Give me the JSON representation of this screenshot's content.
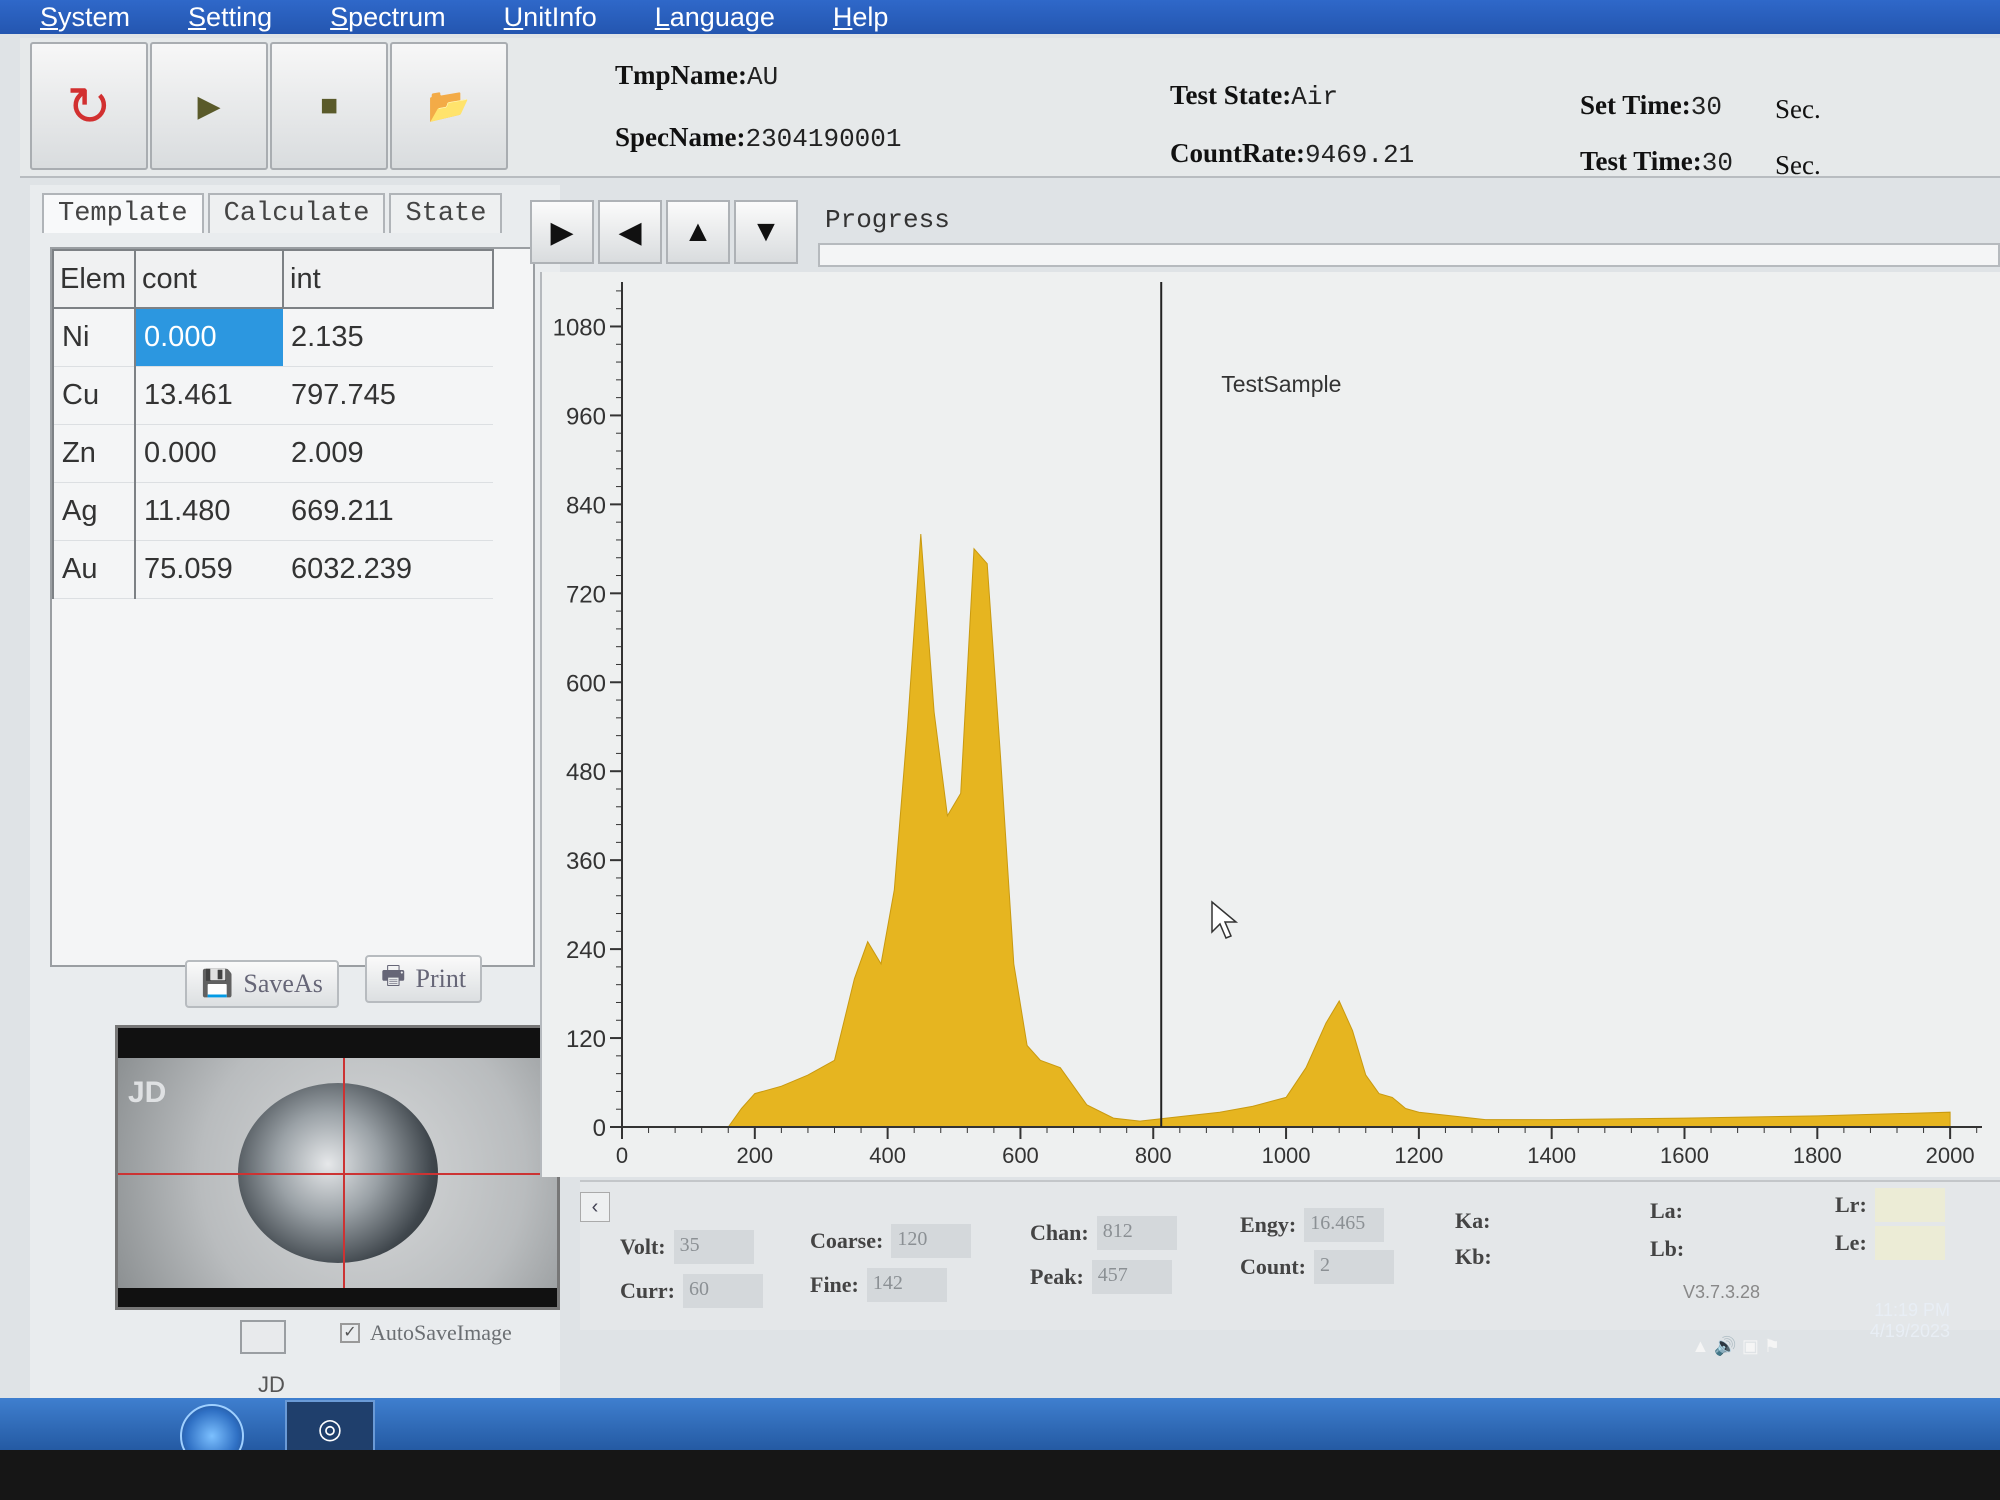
{
  "menu": [
    "System",
    "Setting",
    "Spectrum",
    "UnitInfo",
    "Language",
    "Help"
  ],
  "toolbar": {
    "tmp_label": "TmpName:",
    "tmp_value": "AU",
    "spec_label": "SpecName:",
    "spec_value": "2304190001",
    "state_label": "Test State:",
    "state_value": "Air",
    "rate_label": "CountRate:",
    "rate_value": "9469.21",
    "settime_label": "Set Time:",
    "settime_value": "30",
    "settime_unit": "Sec.",
    "testtime_label": "Test Time:",
    "testtime_value": "30",
    "testtime_unit": "Sec."
  },
  "left": {
    "tabs": [
      "Template",
      "Calculate",
      "State"
    ],
    "table": {
      "headers": [
        "Elem",
        "cont",
        "int"
      ],
      "rows": [
        [
          "Ni",
          "0.000",
          "2.135"
        ],
        [
          "Cu",
          "13.461",
          "797.745"
        ],
        [
          "Zn",
          "0.000",
          "2.009"
        ],
        [
          "Ag",
          "11.480",
          "669.211"
        ],
        [
          "Au",
          "75.059",
          "6032.239"
        ]
      ]
    },
    "saveas_label": "SaveAs",
    "print_label": "Print",
    "camera_overlay": "JD",
    "autosave_label": "AutoSaveImage",
    "footer_label": "JD"
  },
  "progress_label": "Progress",
  "chart_data": {
    "type": "area",
    "title": "TestSample",
    "xlim": [
      0,
      2048
    ],
    "ylim": [
      0,
      1140
    ],
    "x_ticks": [
      0,
      200,
      400,
      600,
      800,
      1000,
      1200,
      1400,
      1600,
      1800,
      2000
    ],
    "y_ticks": [
      0,
      120,
      240,
      360,
      480,
      600,
      720,
      840,
      960,
      1080
    ],
    "marker_x": 812,
    "fill_color": "#e6b520",
    "x": [
      0,
      160,
      180,
      200,
      240,
      280,
      320,
      350,
      370,
      390,
      410,
      430,
      450,
      470,
      490,
      510,
      530,
      550,
      570,
      590,
      610,
      630,
      660,
      700,
      740,
      780,
      800,
      850,
      900,
      950,
      1000,
      1030,
      1060,
      1080,
      1100,
      1120,
      1140,
      1160,
      1180,
      1200,
      1260,
      1300,
      1400,
      1600,
      1800,
      2000
    ],
    "y": [
      0,
      0,
      25,
      45,
      55,
      70,
      90,
      200,
      250,
      220,
      320,
      540,
      800,
      560,
      420,
      450,
      780,
      760,
      500,
      220,
      110,
      90,
      80,
      30,
      12,
      8,
      10,
      15,
      20,
      28,
      40,
      80,
      140,
      170,
      130,
      70,
      45,
      40,
      25,
      20,
      14,
      10,
      10,
      12,
      15,
      20
    ]
  },
  "status": {
    "volt_label": "Volt:",
    "volt_value": "35",
    "curr_label": "Curr:",
    "curr_value": "60",
    "coarse_label": "Coarse:",
    "coarse_value": "120",
    "fine_label": "Fine:",
    "fine_value": "142",
    "chan_label": "Chan:",
    "chan_value": "812",
    "peak_label": "Peak:",
    "peak_value": "457",
    "engy_label": "Engy:",
    "engy_value": "16.465",
    "count_label": "Count:",
    "count_value": "2",
    "ka_label": "Ka:",
    "kb_label": "Kb:",
    "la_label": "La:",
    "lb_label": "Lb:",
    "lr_label": "Lr:",
    "le_label": "Le:",
    "version": "V3.7.3.28"
  },
  "taskbar": {
    "time": "11:19 PM",
    "date": "4/19/2023"
  },
  "colors": {
    "selection": "#2c97e0",
    "spectrum": "#e6b520",
    "menubar": "#2f68c9"
  }
}
